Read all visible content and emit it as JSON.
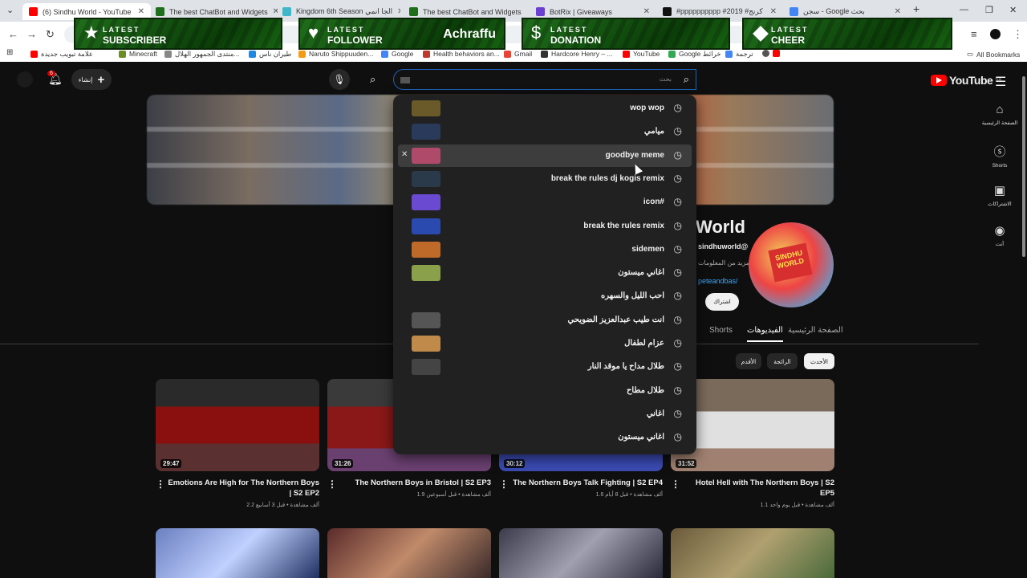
{
  "browser": {
    "tabs": [
      {
        "title": "(6) Sindhu World - YouTube",
        "color": "#ff0000",
        "active": true
      },
      {
        "title": "The best ChatBot and Widgets",
        "color": "#1f6e1b",
        "active": false
      },
      {
        "title": "Kingdom 6th Season الجا انمي",
        "color": "#3fb6c9",
        "active": false
      },
      {
        "title": "The best ChatBot and Widgets",
        "color": "#1f6e1b",
        "active": false
      },
      {
        "title": "BotRix | Giveaways",
        "color": "#6b3fd1",
        "active": false
      },
      {
        "title": "#pppppppppp #2019 #كرنج",
        "color": "#111111",
        "active": false
      },
      {
        "title": "سجن - Google بحث",
        "color": "#4285f4",
        "active": false
      }
    ],
    "bookmarks": [
      {
        "label": "علامة تبويب جديدة",
        "color": "#ff0000"
      },
      {
        "label": "Minecraft",
        "color": "#6b8e23"
      },
      {
        "label": "منتدى الجمهور الهلال...",
        "color": "#888888"
      },
      {
        "label": "طيران ناس",
        "color": "#1e88e5"
      },
      {
        "label": "Naruto Shippuuden...",
        "color": "#f39c12"
      },
      {
        "label": "Google",
        "color": "#4285f4"
      },
      {
        "label": "Health behaviors an...",
        "color": "#c0392b"
      },
      {
        "label": "Gmail",
        "color": "#ea4335"
      },
      {
        "label": "Hardcore Henry – ...",
        "color": "#333333"
      },
      {
        "label": "YouTube",
        "color": "#ff0000"
      },
      {
        "label": "Google خرائط",
        "color": "#34a853"
      },
      {
        "label": "ترجمة",
        "color": "#4285f4"
      }
    ],
    "all_bookmarks": "All Bookmarks"
  },
  "overlays": [
    {
      "line1": "LATEST",
      "line2": "SUBSCRIBER",
      "icon": "star-icon",
      "name": ""
    },
    {
      "line1": "LATEST",
      "line2": "FOLLOWER",
      "icon": "heart-icon",
      "name": "Achraffu"
    },
    {
      "line1": "LATEST",
      "line2": "DONATION",
      "icon": "dollar-icon",
      "name": ""
    },
    {
      "line1": "LATEST",
      "line2": "CHEER",
      "icon": "diamond-icon",
      "name": ""
    }
  ],
  "youtube": {
    "logo": "YouTube",
    "region": "SA",
    "search_placeholder": "بحث",
    "create_label": "إنشاء",
    "notif_count": "6",
    "sidebar": [
      {
        "label": "الصفحة الرئيسية",
        "icon": "home-icon"
      },
      {
        "label": "Shorts",
        "icon": "shorts-icon"
      },
      {
        "label": "الاشتراكات",
        "icon": "subscriptions-icon"
      },
      {
        "label": "أنت",
        "icon": "you-icon"
      }
    ],
    "channel": {
      "name": "World",
      "handle": "sindhuworld@",
      "more": "مزيد من المعلومات",
      "link": "peteandbas/",
      "subscribe": "اشتراك"
    },
    "channel_tabs": [
      "الصفحة الرئيسية",
      "الفيديوهات",
      "Shorts"
    ],
    "chips": [
      "الأحدث",
      "الرائجة",
      "الأقدم"
    ],
    "videos": [
      {
        "title": "Emotions Are High for The Northern Boys | S2 EP2",
        "meta": "2.2 ألف مشاهدة • قبل 3 أسابيع",
        "duration": "29:47"
      },
      {
        "title": "The Northern Boys in Bristol | S2 EP3",
        "meta": "1.9 ألف مشاهدة • قبل أسبوعين",
        "duration": "31:26"
      },
      {
        "title": "The Northern Boys Talk Fighting | S2 EP4",
        "meta": "1.6 ألف مشاهدة • قبل 8 أيام",
        "duration": "30:12"
      },
      {
        "title": "Hotel Hell with The Northern Boys | S2 EP5",
        "meta": "1.1 ألف مشاهدة • قبل يوم واحد",
        "duration": "31:52"
      }
    ],
    "suggestions": [
      {
        "text": "wop wop",
        "thumb": "#6a5a2a"
      },
      {
        "text": "ميامي",
        "thumb": "#2a3a5a"
      },
      {
        "text": "goodbye meme",
        "thumb": "#b04a6a",
        "highlighted": true
      },
      {
        "text": "break the rules dj kogis remix",
        "thumb": "#2a3a4a"
      },
      {
        "text": "icon#",
        "thumb": "#6a4ad0"
      },
      {
        "text": "break the rules remix",
        "thumb": "#2a4ab0"
      },
      {
        "text": "sidemen",
        "thumb": "#c06a2a"
      },
      {
        "text": "اغاني ميستون",
        "thumb": "#8aa04a"
      },
      {
        "text": "احب الليل والسهره",
        "thumb": "#212121"
      },
      {
        "text": "انت طيب عبدالعزيز الضويحي",
        "thumb": "#555555"
      },
      {
        "text": "عزام لطفال",
        "thumb": "#c08a4a"
      },
      {
        "text": "طلال مداح يا موقد النار",
        "thumb": "#444444"
      },
      {
        "text": "طلال مطاح",
        "thumb": "#212121"
      },
      {
        "text": "اغاني",
        "thumb": "#212121"
      },
      {
        "text": "اغاني ميستون",
        "thumb": "#212121"
      }
    ]
  }
}
